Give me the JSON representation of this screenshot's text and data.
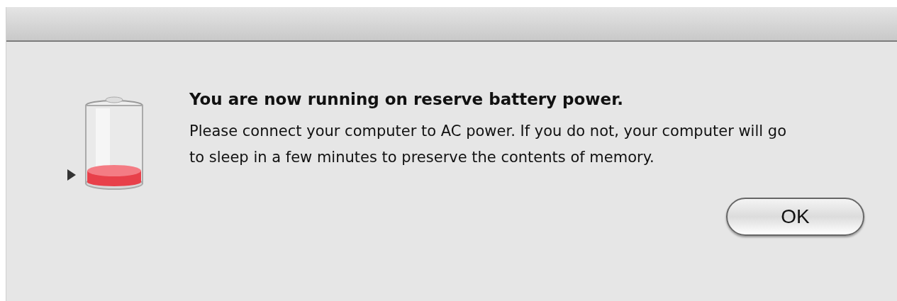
{
  "alert": {
    "title": "You are now running on reserve battery power.",
    "message": "Please connect your computer to AC power. If you do not, your computer will go to sleep in a few minutes to preserve the contents of memory.",
    "buttons": [
      {
        "label": "OK",
        "default": true
      }
    ]
  }
}
